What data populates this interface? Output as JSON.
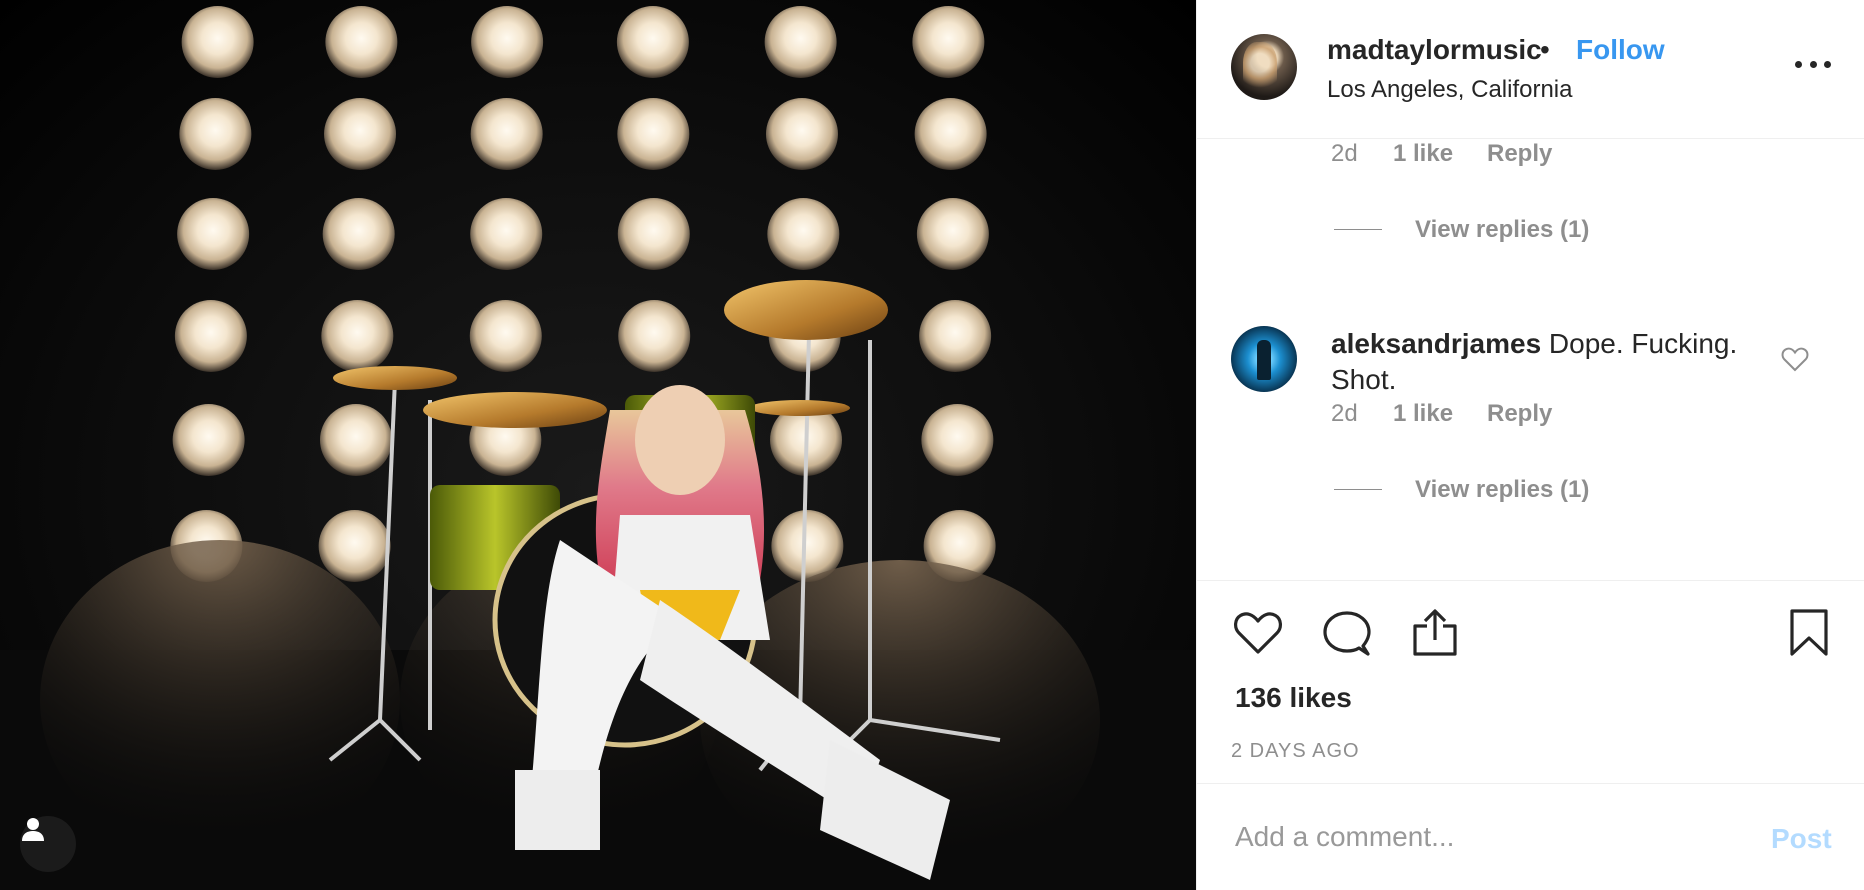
{
  "post": {
    "photo_icon": "drummer-photo",
    "tag_icon": "user-tag-icon"
  },
  "header": {
    "username": "madtaylormusic",
    "separator": "•",
    "follow_label": "Follow",
    "location": "Los Angeles, California",
    "more_icon": "more-options-icon"
  },
  "comments": [
    {
      "username": "",
      "text": "",
      "age": "2d",
      "likes": "1 like",
      "reply_label": "Reply",
      "view_replies": "View replies (1)"
    },
    {
      "username": "aleksandrjames",
      "text": " Dope. Fucking. Shot.",
      "age": "2d",
      "likes": "1 like",
      "reply_label": "Reply",
      "view_replies": "View replies (1)",
      "like_icon": "heart-outline-icon"
    }
  ],
  "actions": {
    "like_icon": "heart-icon",
    "comment_icon": "comment-icon",
    "share_icon": "share-icon",
    "save_icon": "bookmark-icon",
    "likes_count": "136 likes",
    "posted": "2 DAYS AGO"
  },
  "add_comment": {
    "placeholder": "Add a comment...",
    "post_label": "Post"
  },
  "colors": {
    "link": "#3897f0",
    "muted": "#8e8e8e",
    "post_disabled": "#b3dbff"
  }
}
